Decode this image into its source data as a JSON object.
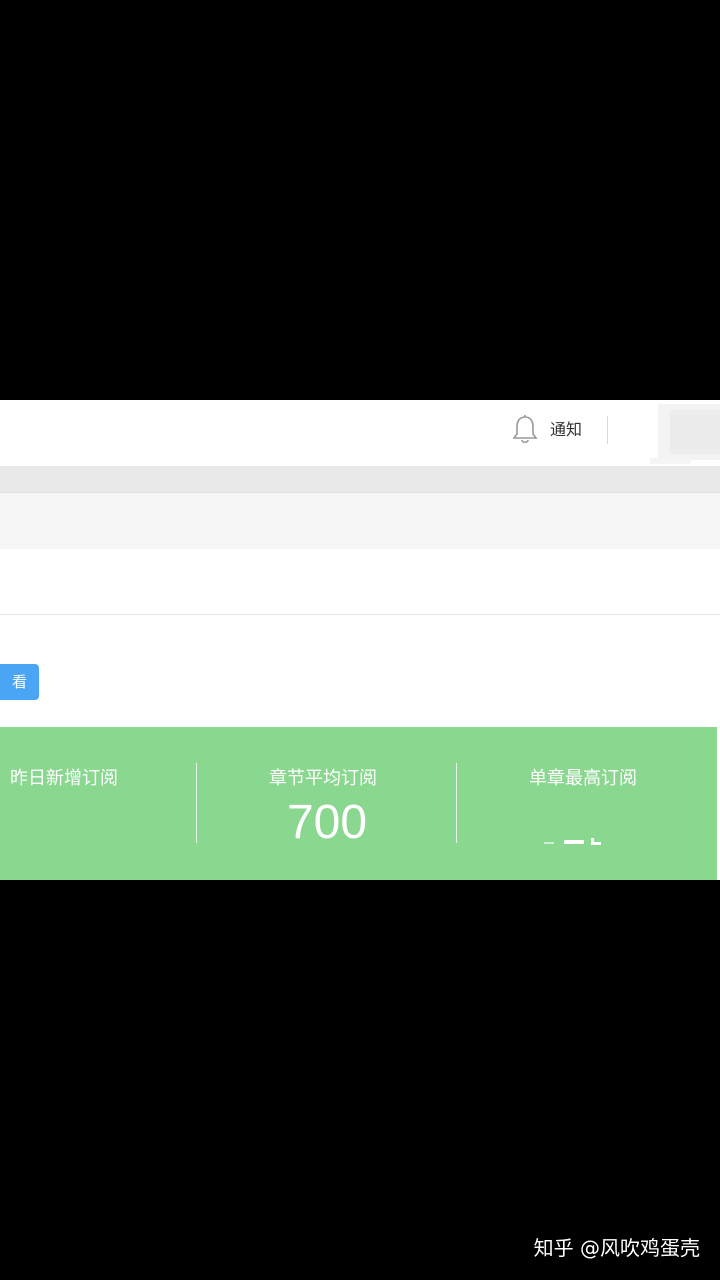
{
  "header": {
    "notification_label": "通知",
    "bell_icon": "bell-icon"
  },
  "toolbar": {
    "view_button_label": "看"
  },
  "stats": [
    {
      "label": "昨日新增订阅",
      "value": ""
    },
    {
      "label": "章节平均订阅",
      "value": "700"
    },
    {
      "label": "单章最高订阅",
      "value": ""
    }
  ],
  "watermark": {
    "text": "知乎 @风吹鸡蛋壳"
  },
  "colors": {
    "stats_panel": "#8ad790",
    "button": "#4aa6f4",
    "background": "#000000"
  }
}
